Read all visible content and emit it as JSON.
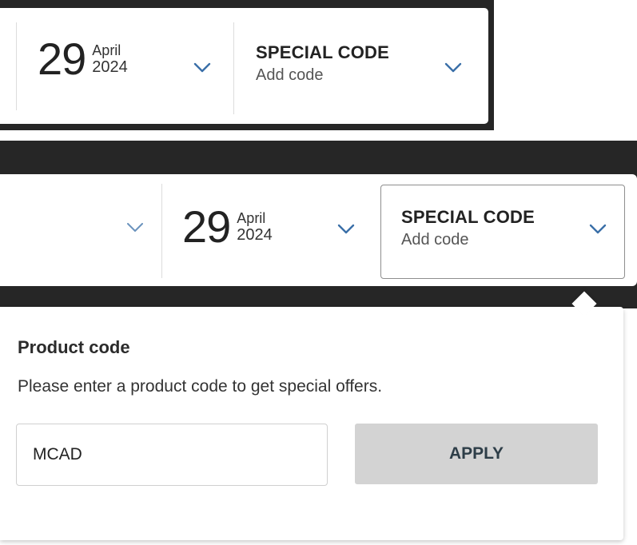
{
  "top_panel": {
    "date": {
      "day": "29",
      "month": "April",
      "year": "2024"
    },
    "special_code": {
      "title": "SPECIAL CODE",
      "value": "Add code"
    }
  },
  "bottom_panel": {
    "date": {
      "day": "29",
      "month": "April",
      "year": "2024"
    },
    "special_code": {
      "title": "SPECIAL CODE",
      "value": "Add code"
    },
    "popover": {
      "title": "Product code",
      "description": "Please enter a product code to get special offers.",
      "input_value": "MCAD",
      "apply_label": "APPLY"
    }
  },
  "colors": {
    "dark_background": "#262626",
    "chevron": "#3a6fa8",
    "apply_button_bg": "#d3d3d3",
    "apply_button_text": "#2e3e48",
    "input_border": "#d0d0d0"
  },
  "icons": {
    "chevron": "chevron-down-icon"
  }
}
